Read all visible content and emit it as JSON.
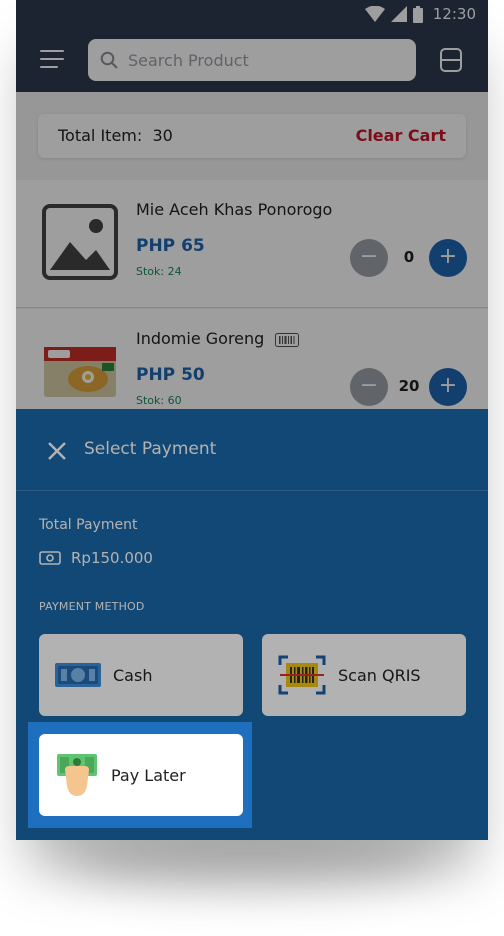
{
  "status_bar": {
    "time": "12:30"
  },
  "header": {
    "search_placeholder": "Search Product"
  },
  "cart": {
    "total_label": "Total Item:",
    "total_value": "30",
    "clear_label": "Clear Cart"
  },
  "products": [
    {
      "name": "Mie Aceh Khas Ponorogo",
      "price": "PHP 65",
      "stock": "Stok: 24",
      "qty": "0",
      "minus": "−",
      "plus": "+"
    },
    {
      "name": "Indomie Goreng",
      "price": "PHP 50",
      "stock": "Stok: 60",
      "qty": "20",
      "minus": "−",
      "plus": "+"
    }
  ],
  "payment": {
    "title": "Select Payment",
    "total_label": "Total Payment",
    "total_amount": "Rp150.000",
    "method_label": "PAYMENT METHOD",
    "methods": [
      {
        "label": "Cash",
        "icon": "cash-icon"
      },
      {
        "label": "Scan QRIS",
        "icon": "qris-scan-icon"
      },
      {
        "label": "Pay Later",
        "icon": "pay-later-icon",
        "selected": true
      }
    ]
  },
  "colors": {
    "header_bg": "#2d3a4e",
    "accent_blue": "#1f66b3",
    "danger_red": "#c9172c",
    "stock_green": "#1f8a56",
    "sheet_blue": "#1a67a8"
  }
}
